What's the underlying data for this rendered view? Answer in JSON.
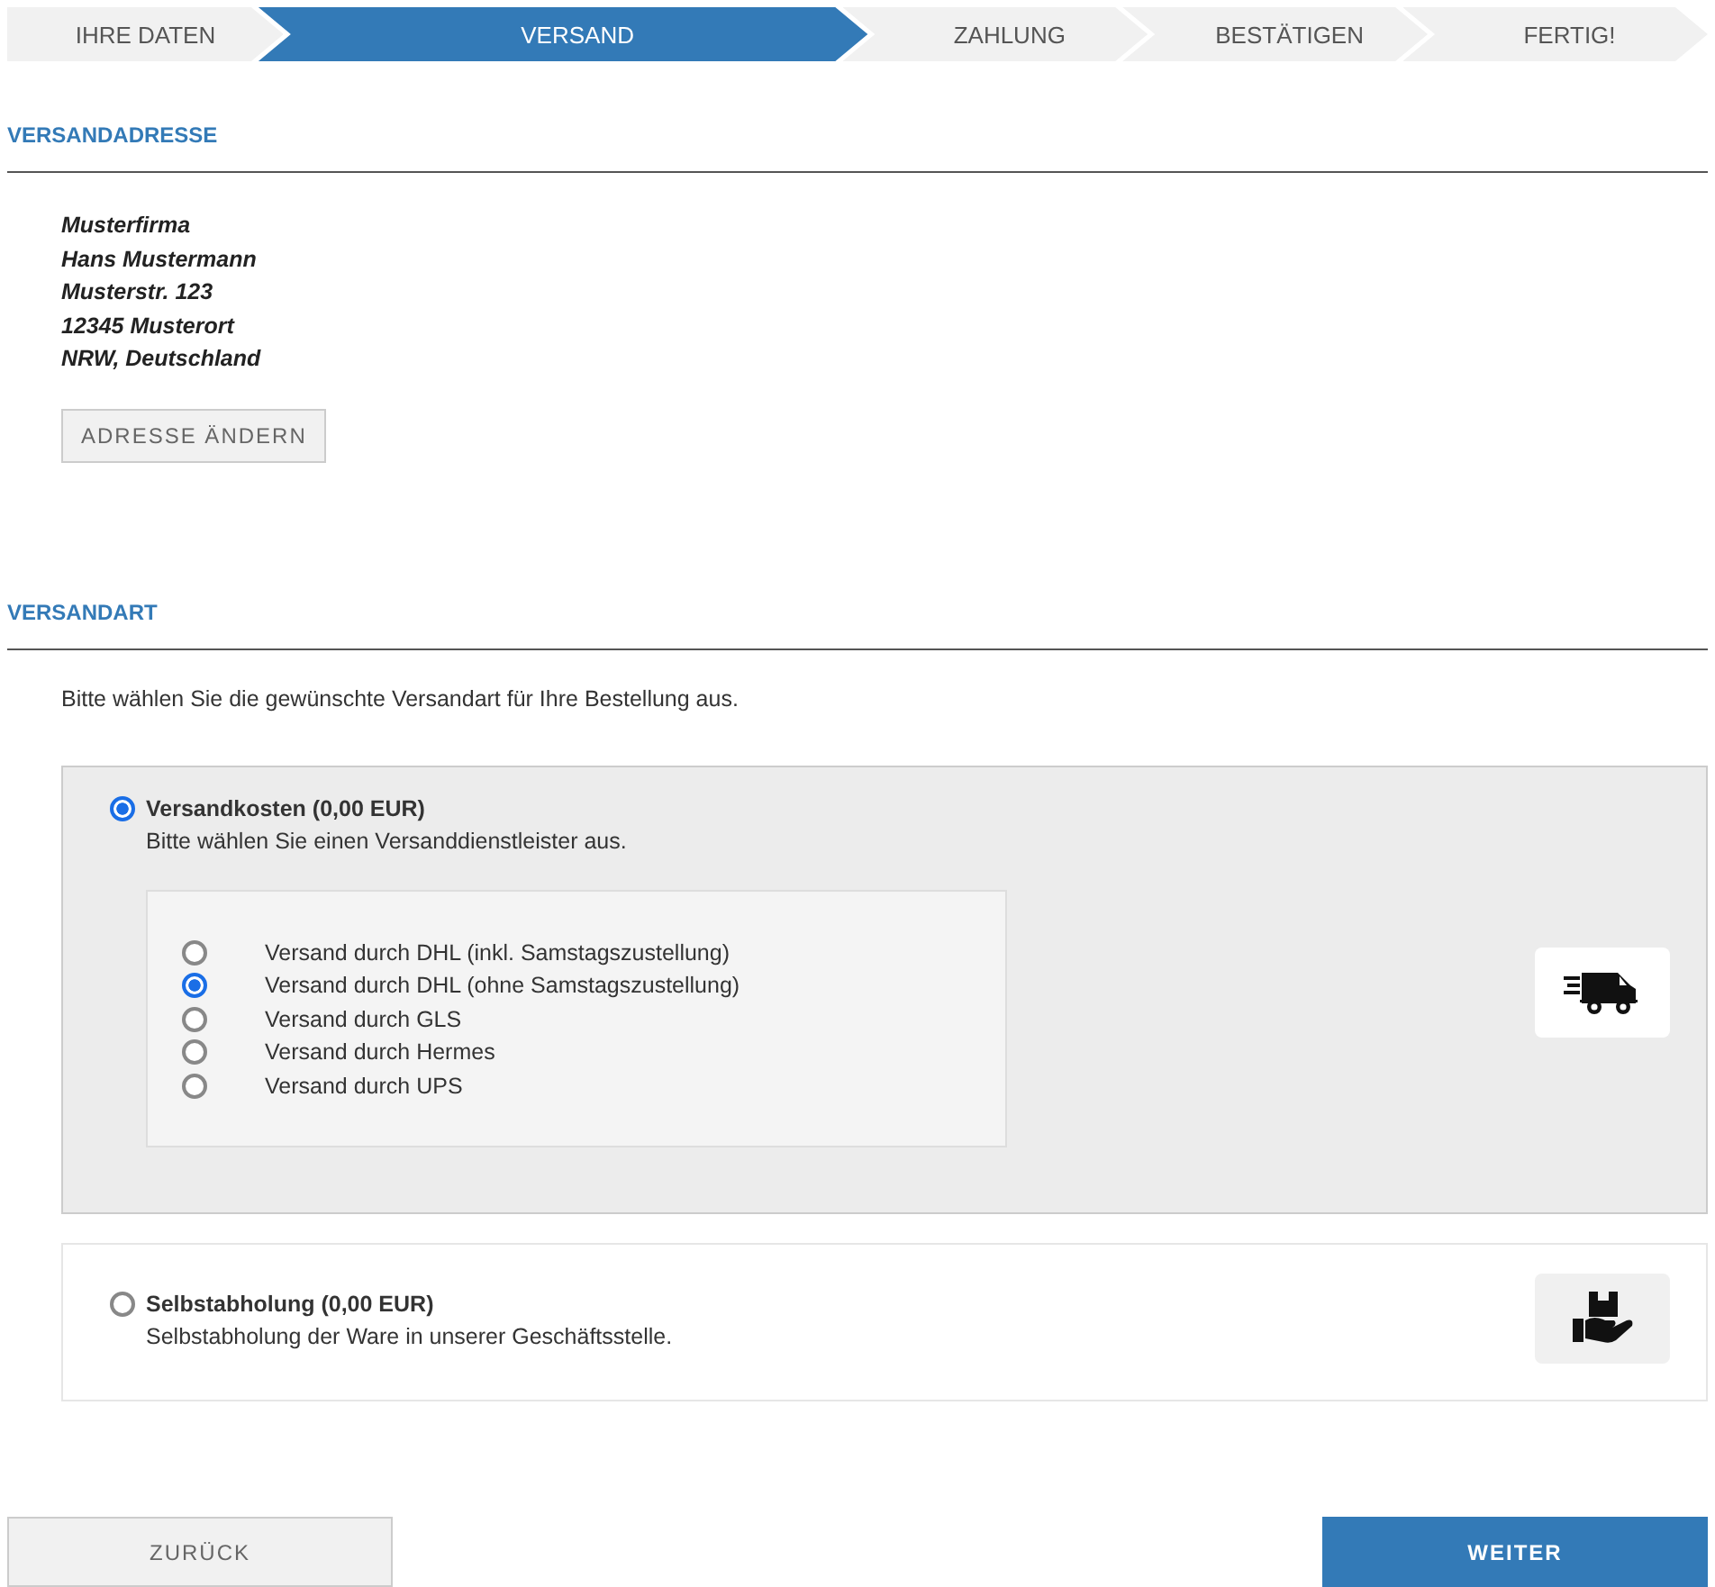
{
  "steps": [
    {
      "label": "IHRE DATEN",
      "selected": false
    },
    {
      "label": "VERSAND",
      "selected": true
    },
    {
      "label": "ZAHLUNG",
      "selected": false
    },
    {
      "label": "BESTÄTIGEN",
      "selected": false
    },
    {
      "label": "FERTIG!",
      "selected": false
    }
  ],
  "address_section": {
    "title": "VERSANDADRESSE",
    "lines": [
      "Musterfirma",
      "Hans Mustermann",
      "Musterstr. 123",
      "12345 Musterort",
      "NRW, Deutschland"
    ],
    "button": "ADRESSE ÄNDERN"
  },
  "shipping_section": {
    "title": "VERSANDART",
    "intro": "Bitte wählen Sie die gewünschte Versandart für Ihre Bestellung aus.",
    "methods": [
      {
        "kind": "delivery",
        "title": "Versandkosten (0,00 EUR)",
        "description": "Bitte wählen Sie einen Versanddienstleister aus.",
        "selected": true,
        "carriers": [
          {
            "label": "Versand durch DHL (inkl. Samstagszustellung)",
            "selected": false
          },
          {
            "label": "Versand durch DHL (ohne Samstagszustellung)",
            "selected": true
          },
          {
            "label": "Versand durch GLS",
            "selected": false
          },
          {
            "label": "Versand durch Hermes",
            "selected": false
          },
          {
            "label": "Versand durch UPS",
            "selected": false
          }
        ]
      },
      {
        "kind": "pickup",
        "title": "Selbstabholung (0,00 EUR)",
        "description": "Selbstabholung der Ware in unserer Geschäftsstelle.",
        "selected": false
      }
    ]
  },
  "buttons": {
    "back": "ZURÜCK",
    "next": "WEITER"
  }
}
